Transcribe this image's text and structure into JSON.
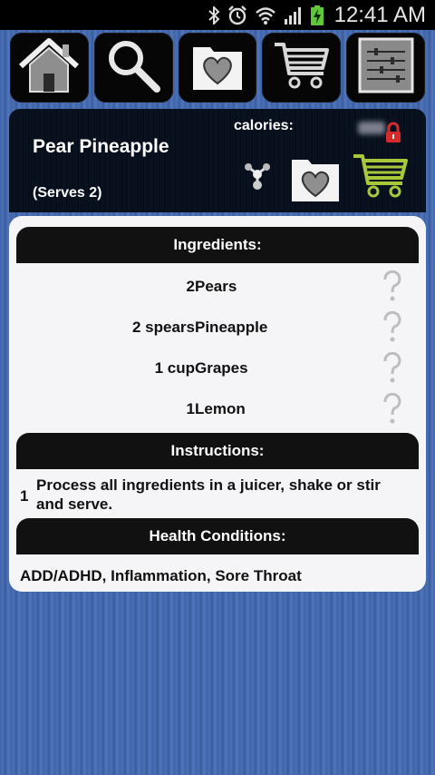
{
  "status_bar": {
    "time": "12:41 AM",
    "icons": [
      "bluetooth-icon",
      "alarm-icon",
      "wifi-icon",
      "signal-icon",
      "battery-charging-icon"
    ]
  },
  "toolbar": {
    "buttons": [
      {
        "name": "home",
        "icon": "home-icon"
      },
      {
        "name": "search",
        "icon": "search-icon"
      },
      {
        "name": "favorites",
        "icon": "heart-folder-icon"
      },
      {
        "name": "shopping-cart",
        "icon": "cart-icon"
      },
      {
        "name": "settings",
        "icon": "sliders-icon"
      }
    ]
  },
  "recipe": {
    "title": "Pear Pineapple",
    "serves": "(Serves 2)",
    "calories_label": "calories:"
  },
  "ingredients": {
    "header": "Ingredients:",
    "items": [
      {
        "qty": "2",
        "name": "Pears"
      },
      {
        "qty": "2 spears",
        "name": "Pineapple"
      },
      {
        "qty": "1 cup",
        "name": "Grapes"
      },
      {
        "qty": "1",
        "name": "Lemon"
      }
    ]
  },
  "instructions": {
    "header": "Instructions:",
    "steps": [
      {
        "num": "1",
        "text": "Process all ingredients in a juicer, shake or stir and serve."
      }
    ]
  },
  "health": {
    "header": "Health Conditions:",
    "text": "ADD/ADHD, Inflammation, Sore Throat"
  },
  "colors": {
    "accent_green": "#a8c83a",
    "lock_red": "#d62b2b",
    "section_header": "#111111"
  }
}
